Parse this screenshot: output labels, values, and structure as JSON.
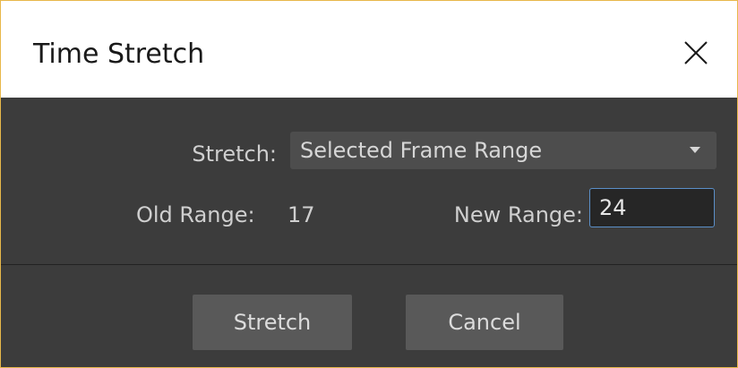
{
  "window": {
    "title": "Time Stretch",
    "close_icon": "close-icon"
  },
  "form": {
    "stretch_label": "Stretch:",
    "stretch_selected": "Selected Frame Range",
    "old_range_label": "Old Range:",
    "old_range_value": "17",
    "new_range_label": "New Range:",
    "new_range_value": "24"
  },
  "buttons": {
    "stretch_label": "Stretch",
    "cancel_label": "Cancel"
  },
  "colors": {
    "window_border": "#e8b84a",
    "dialog_bg": "#3c3c3c",
    "input_focus_border": "#5b8fc8"
  }
}
